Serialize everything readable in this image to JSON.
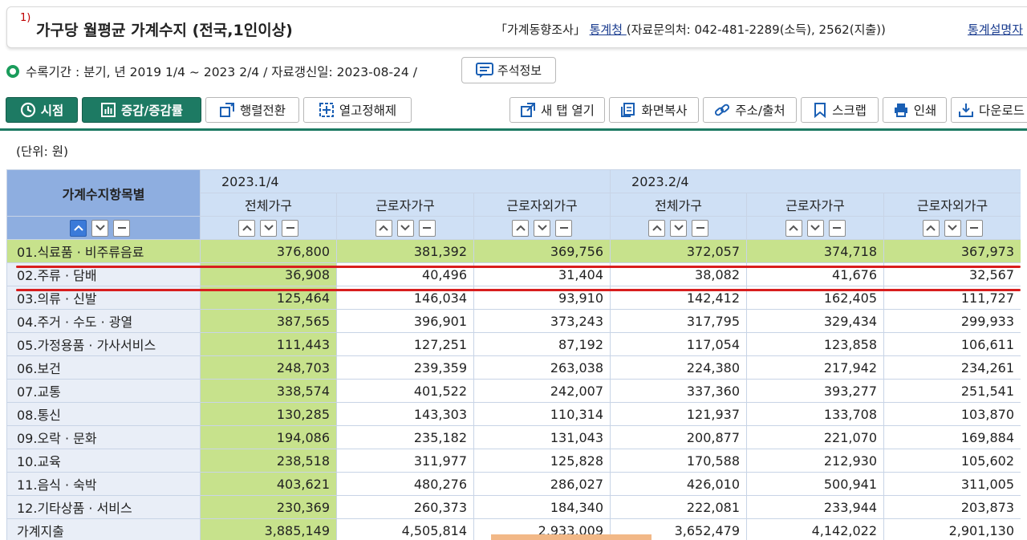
{
  "title": {
    "footnote": "1)",
    "text": "가구당 월평균 가계수지 (전국,1인이상)",
    "survey": "「가계동향조사」",
    "agency_link": "통계청 ",
    "contact": "(자료문의처: 042-481-2289(소득), 2562(지출))",
    "right_link": "통계설명자"
  },
  "meta": {
    "text": "수록기간 : 분기, 년 2019 1/4 ~ 2023 2/4 / 자료갱신일: 2023-08-24 /",
    "note_button": "주석정보"
  },
  "toolbar": {
    "time_btn": "시점",
    "change_btn": "증감/증감률",
    "transpose_btn": "행렬전환",
    "unfix_btn": "열고정해제",
    "newtab_btn": "새 탭 열기",
    "copy_btn": "화면복사",
    "url_btn": "주소/출처",
    "scrap_btn": "스크랩",
    "print_btn": "인쇄",
    "download_btn": "다운로드"
  },
  "unit_text": "(단위: 원)",
  "colors": {
    "accent": "#1d7a63",
    "header": "#cfe0f5",
    "corner": "#8eaee0",
    "highlight": "#c7e28c",
    "redline": "#d81e1e"
  },
  "table": {
    "corner_label": "가계수지항목별",
    "periods": [
      "2023.1/4",
      "2023.2/4"
    ],
    "subcols": [
      "전체가구",
      "근로자가구",
      "근로자외가구",
      "전체가구",
      "근로자가구",
      "근로자외가구"
    ],
    "rows": [
      {
        "label": "01.식료품 · 비주류음료",
        "values": [
          "376,800",
          "381,392",
          "369,756",
          "372,057",
          "374,718",
          "367,973"
        ]
      },
      {
        "label": "02.주류 · 담배",
        "values": [
          "36,908",
          "40,496",
          "31,404",
          "38,082",
          "41,676",
          "32,567"
        ]
      },
      {
        "label": "03.의류 · 신발",
        "values": [
          "125,464",
          "146,034",
          "93,910",
          "142,412",
          "162,405",
          "111,727"
        ]
      },
      {
        "label": "04.주거 · 수도 · 광열",
        "values": [
          "387,565",
          "396,901",
          "373,243",
          "317,795",
          "329,434",
          "299,933"
        ]
      },
      {
        "label": "05.가정용품 · 가사서비스",
        "values": [
          "111,443",
          "127,251",
          "87,192",
          "117,054",
          "123,858",
          "106,611"
        ]
      },
      {
        "label": "06.보건",
        "values": [
          "248,703",
          "239,359",
          "263,038",
          "224,380",
          "217,942",
          "234,261"
        ]
      },
      {
        "label": "07.교통",
        "values": [
          "338,574",
          "401,522",
          "242,007",
          "337,360",
          "393,277",
          "251,541"
        ]
      },
      {
        "label": "08.통신",
        "values": [
          "130,285",
          "143,303",
          "110,314",
          "121,937",
          "133,708",
          "103,870"
        ]
      },
      {
        "label": "09.오락 · 문화",
        "values": [
          "194,086",
          "235,182",
          "131,043",
          "200,877",
          "221,070",
          "169,884"
        ]
      },
      {
        "label": "10.교육",
        "values": [
          "238,518",
          "311,977",
          "125,828",
          "170,588",
          "212,930",
          "105,602"
        ]
      },
      {
        "label": "11.음식 · 숙박",
        "values": [
          "403,621",
          "480,276",
          "286,027",
          "426,010",
          "500,941",
          "311,005"
        ]
      },
      {
        "label": "12.기타상품 · 서비스",
        "values": [
          "230,369",
          "260,373",
          "184,340",
          "222,081",
          "233,944",
          "203,873"
        ]
      },
      {
        "label": "가계지출",
        "values": [
          "3,885,149",
          "4,505,814",
          "2,933,009",
          "3,652,479",
          "4,142,022",
          "2,901,130"
        ]
      }
    ]
  }
}
